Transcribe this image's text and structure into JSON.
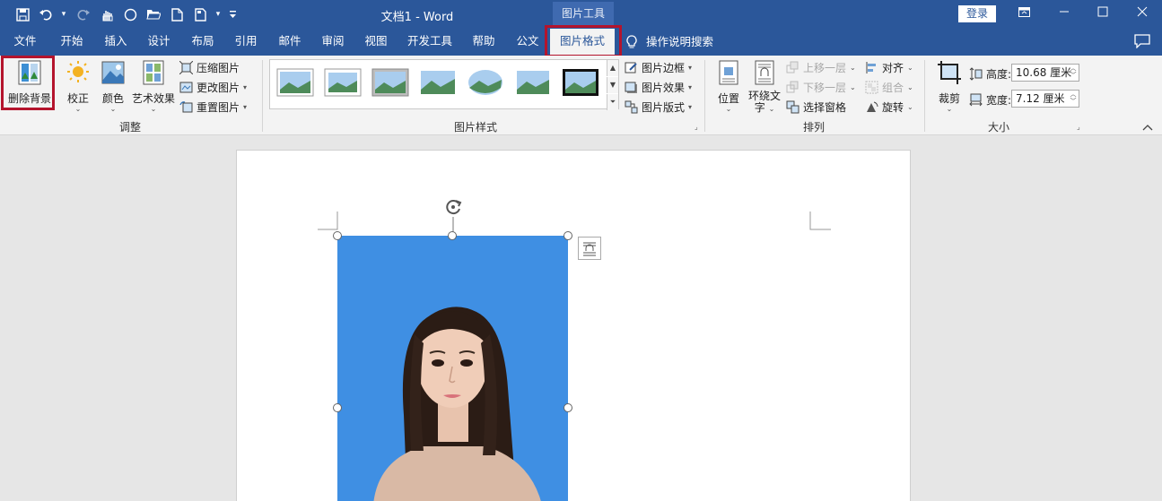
{
  "title_bar": {
    "doc_title": "文档1  -  Word",
    "context_tool": "图片工具",
    "login": "登录",
    "qat_icons": [
      "save-icon",
      "undo-icon",
      "redo-icon",
      "touch-mode-icon",
      "circle-icon",
      "open-icon",
      "new-doc-icon",
      "print-preview-icon",
      "customize-qat-icon"
    ]
  },
  "tabs": [
    {
      "label": "文件"
    },
    {
      "label": "开始"
    },
    {
      "label": "插入"
    },
    {
      "label": "设计"
    },
    {
      "label": "布局"
    },
    {
      "label": "引用"
    },
    {
      "label": "邮件"
    },
    {
      "label": "审阅"
    },
    {
      "label": "视图"
    },
    {
      "label": "开发工具"
    },
    {
      "label": "帮助"
    },
    {
      "label": "公文"
    },
    {
      "label": "图片格式",
      "active": true
    }
  ],
  "help_search": "操作说明搜索",
  "ribbon": {
    "adjust": {
      "label": "调整",
      "remove_bg": "删除背景",
      "corrections": "校正",
      "color": "颜色",
      "artistic": "艺术效果",
      "compress": "压缩图片",
      "change": "更改图片",
      "reset": "重置图片"
    },
    "styles": {
      "label": "图片样式",
      "border": "图片边框",
      "effects": "图片效果",
      "layout": "图片版式"
    },
    "arrange": {
      "label": "排列",
      "position": "位置",
      "wrap_line1": "环绕文",
      "wrap_line2": "字",
      "bring_forward": "上移一层",
      "send_backward": "下移一层",
      "selection_pane": "选择窗格",
      "align": "对齐",
      "group": "组合",
      "rotate": "旋转"
    },
    "size": {
      "label": "大小",
      "crop": "裁剪",
      "height_label": "高度:",
      "height_value": "10.68 厘米",
      "width_label": "宽度:",
      "width_value": "7.12 厘米"
    }
  },
  "colors": {
    "title_bar": "#2b579a",
    "highlight": "#b4142d",
    "photo_bg": "#3f8fe3"
  }
}
